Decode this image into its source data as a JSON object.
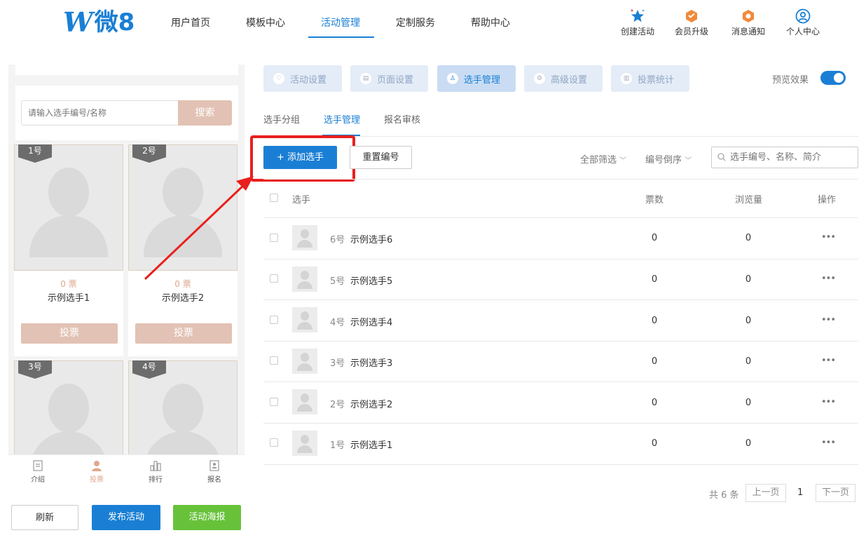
{
  "logo": {
    "mark": "W",
    "text": "微8"
  },
  "nav": {
    "items": [
      "用户首页",
      "模板中心",
      "活动管理",
      "定制服务",
      "帮助中心"
    ],
    "active_index": 2
  },
  "top_actions": [
    {
      "label": "创建活动",
      "icon": "star-icon"
    },
    {
      "label": "会员升级",
      "icon": "vip-badge-icon"
    },
    {
      "label": "消息通知",
      "icon": "notification-badge-icon"
    },
    {
      "label": "个人中心",
      "icon": "user-circle-icon"
    }
  ],
  "preview": {
    "search_placeholder": "请输入选手编号/名称",
    "search_button": "搜索",
    "cards": [
      {
        "badge": "1号",
        "votes": "0 票",
        "name": "示例选手1",
        "vote_button": "投票"
      },
      {
        "badge": "2号",
        "votes": "0 票",
        "name": "示例选手2",
        "vote_button": "投票"
      },
      {
        "badge": "3号"
      },
      {
        "badge": "4号"
      }
    ],
    "bottom_tabs": [
      "介绍",
      "投票",
      "排行",
      "报名"
    ],
    "bottom_tab_active": 1
  },
  "left_buttons": {
    "refresh": "刷新",
    "publish": "发布活动",
    "poster": "活动海报"
  },
  "colors": {
    "accent": "#1a7fd4",
    "vote_tan": "#e2c2b4",
    "poster_green": "#67c23a",
    "highlight_red": "#e8201e"
  },
  "settings_tabs": [
    "活动设置",
    "页面设置",
    "选手管理",
    "高级设置",
    "投票统计"
  ],
  "settings_tab_active": 2,
  "preview_toggle": {
    "label": "预览效果",
    "on": true
  },
  "sub_tabs": [
    "选手分组",
    "选手管理",
    "报名审核"
  ],
  "sub_tab_active": 1,
  "toolbar": {
    "add_button": "+ 添加选手",
    "reset_button": "重置编号",
    "filter_all": "全部筛选",
    "sort": "编号倒序",
    "search_placeholder": "选手编号、名称、简介"
  },
  "table": {
    "headers": {
      "player": "选手",
      "votes": "票数",
      "views": "浏览量",
      "actions": "操作"
    },
    "rows": [
      {
        "num": "6号",
        "name": "示例选手6",
        "votes": "0",
        "views": "0",
        "more": "•••"
      },
      {
        "num": "5号",
        "name": "示例选手5",
        "votes": "0",
        "views": "0",
        "more": "•••"
      },
      {
        "num": "4号",
        "name": "示例选手4",
        "votes": "0",
        "views": "0",
        "more": "•••"
      },
      {
        "num": "3号",
        "name": "示例选手3",
        "votes": "0",
        "views": "0",
        "more": "•••"
      },
      {
        "num": "2号",
        "name": "示例选手2",
        "votes": "0",
        "views": "0",
        "more": "•••"
      },
      {
        "num": "1号",
        "name": "示例选手1",
        "votes": "0",
        "views": "0",
        "more": "•••"
      }
    ]
  },
  "pagination": {
    "total": "共 6 条",
    "prev": "上一页",
    "current": "1",
    "next": "下一页"
  }
}
